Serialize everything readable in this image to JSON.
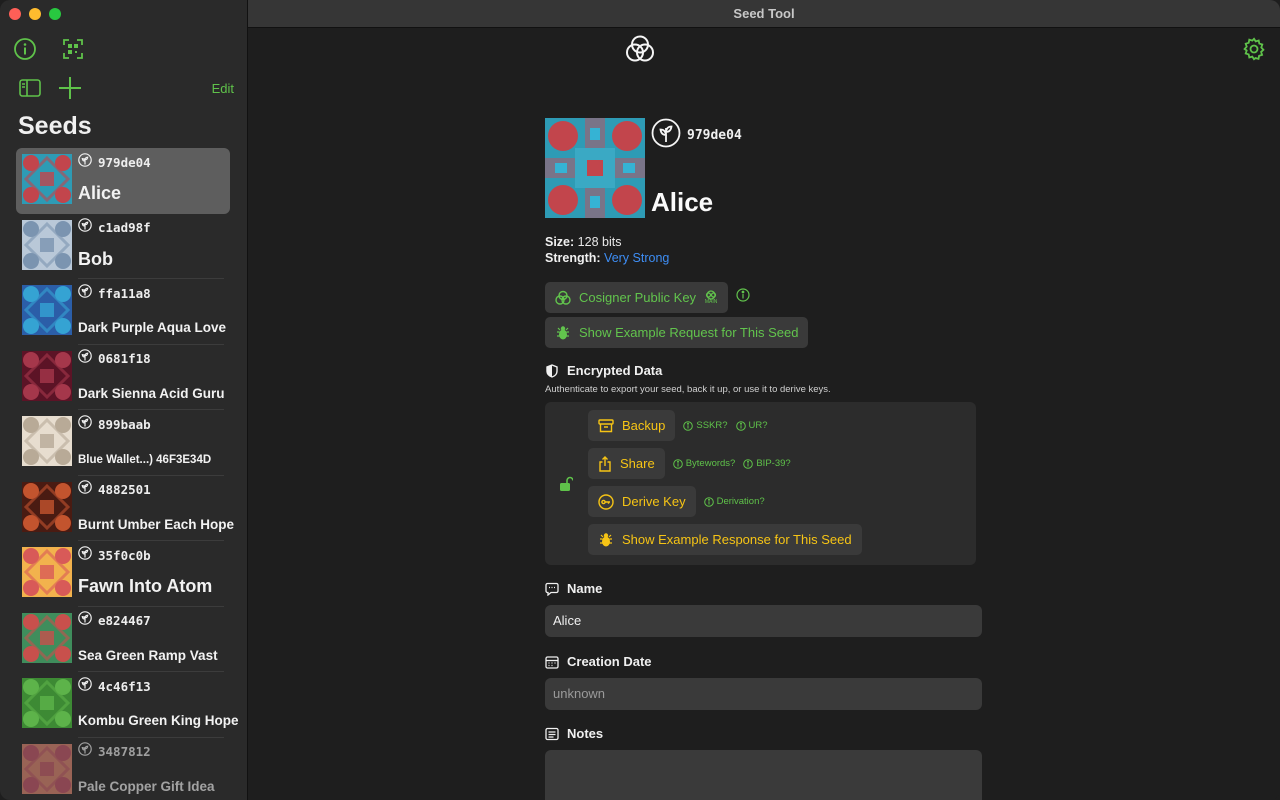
{
  "window": {
    "title": "Seed Tool"
  },
  "sidebar": {
    "edit_label": "Edit",
    "title": "Seeds",
    "seeds": [
      {
        "id": "979de04",
        "name": "Alice",
        "size": "l",
        "colors": [
          "#2e9bb5",
          "#c2454c"
        ],
        "selected": true
      },
      {
        "id": "c1ad98f",
        "name": "Bob",
        "size": "l",
        "colors": [
          "#b9c8d8",
          "#7b94b0"
        ]
      },
      {
        "id": "ffa11a8",
        "name": "Dark Purple Aqua Love",
        "size": "m",
        "colors": [
          "#2b5ea8",
          "#35a3d3"
        ]
      },
      {
        "id": "0681f18",
        "name": "Dark Sienna Acid Guru",
        "size": "m",
        "colors": [
          "#5c1326",
          "#a5374b"
        ]
      },
      {
        "id": "899baab",
        "name": "Blue Wallet...) 46F3E34D",
        "size": "s",
        "colors": [
          "#e7ddcf",
          "#b8aa97"
        ]
      },
      {
        "id": "4882501",
        "name": "Burnt Umber Each Hope",
        "size": "m",
        "colors": [
          "#4a1b12",
          "#c3542e"
        ]
      },
      {
        "id": "35f0c0b",
        "name": "Fawn Into Atom",
        "size": "l",
        "colors": [
          "#f2b24d",
          "#d85a58"
        ]
      },
      {
        "id": "e824467",
        "name": "Sea Green Ramp Vast",
        "size": "m",
        "colors": [
          "#3f8d5c",
          "#c8504c"
        ]
      },
      {
        "id": "4c46f13",
        "name": "Kombu Green King Hope",
        "size": "m",
        "colors": [
          "#3d8a34",
          "#5db34a"
        ]
      },
      {
        "id": "3487812",
        "name": "Pale Copper Gift Idea",
        "size": "m",
        "colors": [
          "#e48a74",
          "#cb5b6e"
        ],
        "dim": true
      }
    ]
  },
  "detail": {
    "id": "979de04",
    "name": "Alice",
    "size_label": "Size:",
    "size_value": "128 bits",
    "strength_label": "Strength:",
    "strength_value": "Very Strong",
    "cosigner_label": "Cosigner Public Key",
    "cosigner_badge": "MAIN",
    "example_request_label": "Show Example Request for This Seed",
    "encrypted": {
      "title": "Encrypted Data",
      "subtitle": "Authenticate to export your seed, back it up, or use it to derive keys.",
      "backup_label": "Backup",
      "backup_hints": [
        "SSKR?",
        "UR?"
      ],
      "share_label": "Share",
      "share_hints": [
        "Bytewords?",
        "BIP-39?"
      ],
      "derive_label": "Derive Key",
      "derive_hints": [
        "Derivation?"
      ],
      "example_response_label": "Show Example Response for This Seed"
    },
    "name_field": {
      "label": "Name",
      "value": "Alice"
    },
    "creation_date": {
      "label": "Creation Date",
      "placeholder": "unknown"
    },
    "notes": {
      "label": "Notes"
    }
  },
  "colors": {
    "accent_green": "#5fc24a",
    "accent_yellow": "#f6c415",
    "link_blue": "#3e8ef5"
  }
}
